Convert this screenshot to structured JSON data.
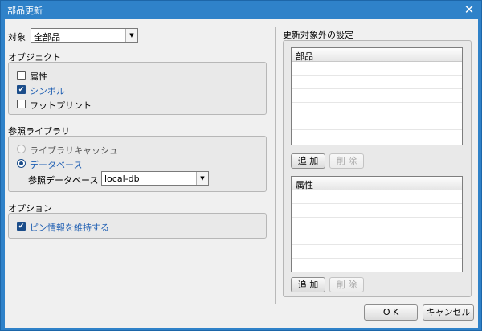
{
  "window": {
    "title": "部品更新",
    "close_symbol": "✕"
  },
  "target": {
    "label": "対象",
    "value": "全部品"
  },
  "objects": {
    "heading": "オブジェクト",
    "items": [
      {
        "label": "属性",
        "checked": false
      },
      {
        "label": "シンボル",
        "checked": true
      },
      {
        "label": "フットプリント",
        "checked": false
      }
    ]
  },
  "reference_library": {
    "heading": "参照ライブラリ",
    "options": [
      {
        "label": "ライブラリキャッシュ",
        "selected": false
      },
      {
        "label": "データベース",
        "selected": true
      }
    ],
    "database_label": "参照データベース",
    "database_value": "local-db"
  },
  "options": {
    "heading": "オプション",
    "items": [
      {
        "label": "ピン情報を維持する",
        "checked": true
      }
    ]
  },
  "exclusions": {
    "heading": "更新対象外の設定",
    "parts_list": {
      "header": "部品",
      "add_label": "追 加",
      "remove_label": "削 除"
    },
    "attributes_list": {
      "header": "属性",
      "add_label": "追 加",
      "remove_label": "削 除"
    }
  },
  "footer": {
    "ok_label": "O K",
    "cancel_label": "キャンセル"
  },
  "colors": {
    "titlebar": "#2f82c9",
    "accent_text": "#1f5fb3",
    "checkbox": "#1b4d8a"
  }
}
